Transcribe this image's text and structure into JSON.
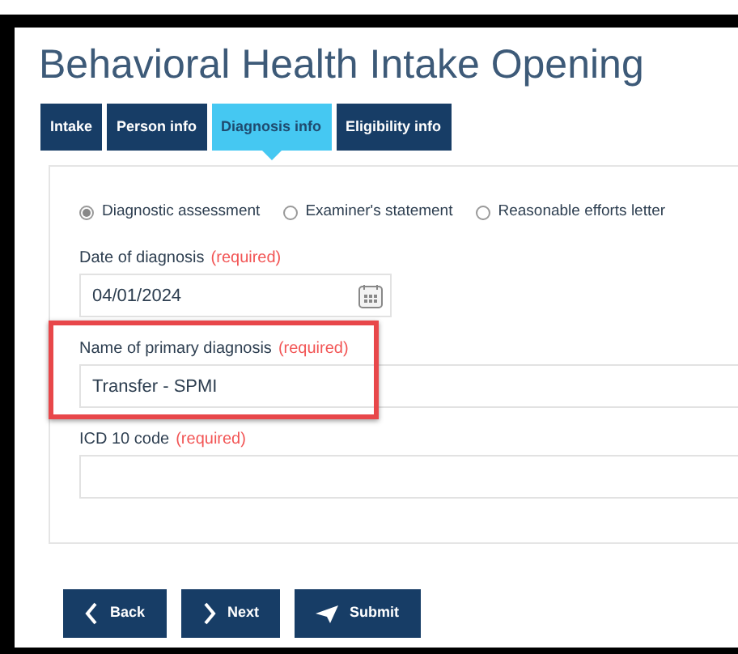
{
  "title": "Behavioral Health Intake Opening",
  "tabs": [
    {
      "label": "Intake",
      "selected": false
    },
    {
      "label": "Person info",
      "selected": false
    },
    {
      "label": "Diagnosis info",
      "selected": true
    },
    {
      "label": "Eligibility info",
      "selected": false
    }
  ],
  "radios": [
    {
      "label": "Diagnostic assessment",
      "selected": true
    },
    {
      "label": "Examiner's statement",
      "selected": false
    },
    {
      "label": "Reasonable efforts letter",
      "selected": false
    }
  ],
  "fields": [
    {
      "kind": "date",
      "label": "Date of diagnosis",
      "required_note": "(required)",
      "value": "04/01/2024",
      "highlighted": false
    },
    {
      "kind": "text",
      "label": "Name of primary diagnosis",
      "required_note": "(required)",
      "value": "Transfer - SPMI",
      "highlighted": true
    },
    {
      "kind": "text",
      "label": "ICD 10 code",
      "required_note": "(required)",
      "highlighted": false
    }
  ],
  "buttons": [
    {
      "kind": "back",
      "label": "Back"
    },
    {
      "kind": "next",
      "label": "Next"
    },
    {
      "kind": "submit",
      "label": "Submit"
    }
  ]
}
